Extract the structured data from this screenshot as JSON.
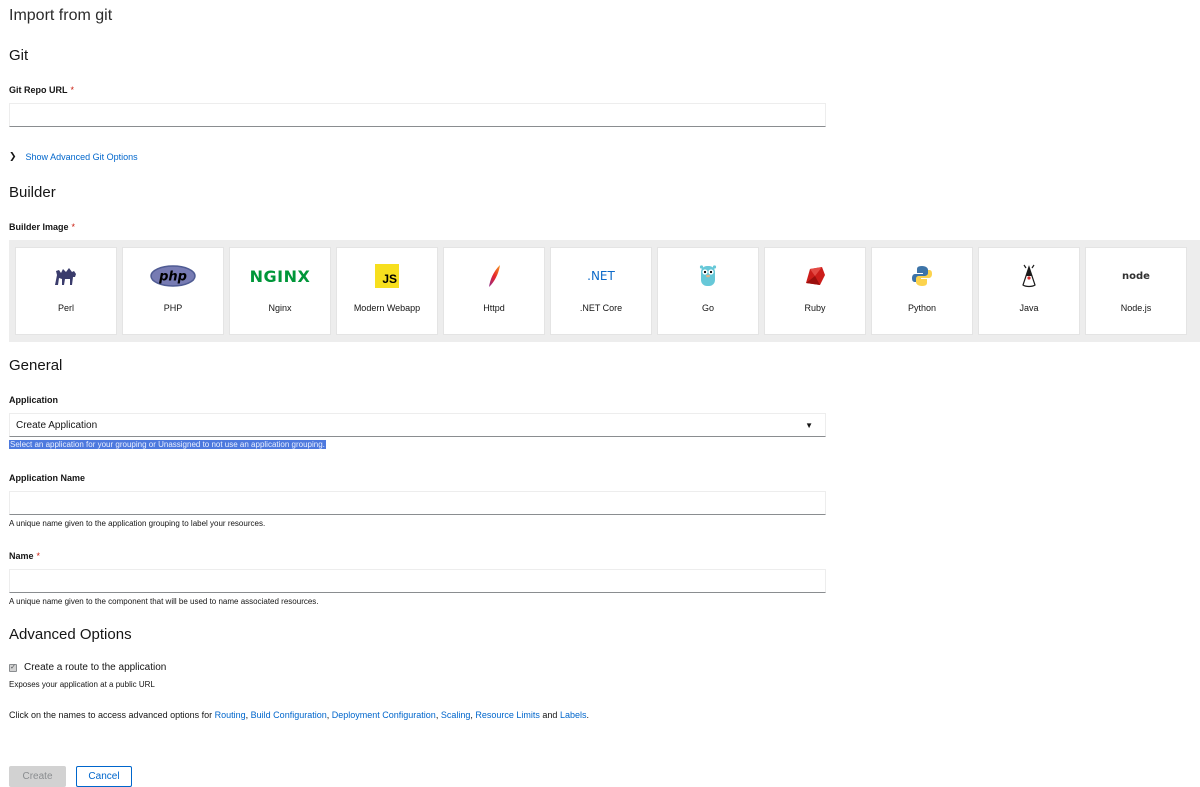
{
  "page": {
    "title": "Import from git"
  },
  "git": {
    "section_title": "Git",
    "repo_url_label": "Git Repo URL",
    "required_mark": "*",
    "repo_url_value": "",
    "advanced_toggle": "Show Advanced Git Options"
  },
  "builder": {
    "section_title": "Builder",
    "image_label": "Builder Image",
    "required_mark": "*",
    "images": [
      {
        "name": "Perl",
        "icon": "perl-camel-icon"
      },
      {
        "name": "PHP",
        "icon": "php-logo-icon"
      },
      {
        "name": "Nginx",
        "icon": "nginx-logo-icon"
      },
      {
        "name": "Modern Webapp",
        "icon": "js-logo-icon"
      },
      {
        "name": "Httpd",
        "icon": "apache-feather-icon"
      },
      {
        "name": ".NET Core",
        "icon": "dotnet-logo-icon"
      },
      {
        "name": "Go",
        "icon": "go-gopher-icon"
      },
      {
        "name": "Ruby",
        "icon": "ruby-gem-icon"
      },
      {
        "name": "Python",
        "icon": "python-logo-icon"
      },
      {
        "name": "Java",
        "icon": "java-duke-icon"
      },
      {
        "name": "Node.js",
        "icon": "nodejs-logo-icon"
      }
    ],
    "logo_text": {
      "php": "php",
      "nginx": "NGINX",
      "js": "JS",
      "dotnet": ".NET",
      "node": "node"
    }
  },
  "general": {
    "section_title": "General",
    "application_label": "Application",
    "application_value": "Create Application",
    "application_helper": "Select an application for your grouping or Unassigned to not use an application grouping.",
    "app_name_label": "Application Name",
    "app_name_value": "",
    "app_name_helper": "A unique name given to the application grouping to label your resources.",
    "name_label": "Name",
    "required_mark": "*",
    "name_value": "",
    "name_helper": "A unique name given to the component that will be used to name associated resources."
  },
  "advanced": {
    "section_title": "Advanced Options",
    "route_checkbox_label": "Create a route to the application",
    "route_checked": true,
    "route_helper": "Exposes your application at a public URL",
    "click_prefix": "Click on the names to access advanced options for ",
    "links": [
      "Routing",
      "Build Configuration",
      "Deployment Configuration",
      "Scaling",
      "Resource Limits",
      "Labels"
    ],
    "sep": ", ",
    "and": " and ",
    "end": "."
  },
  "actions": {
    "create_label": "Create",
    "cancel_label": "Cancel"
  },
  "colors": {
    "link": "#0066cc",
    "required": "#c9190b",
    "selection": "#4d79de"
  }
}
